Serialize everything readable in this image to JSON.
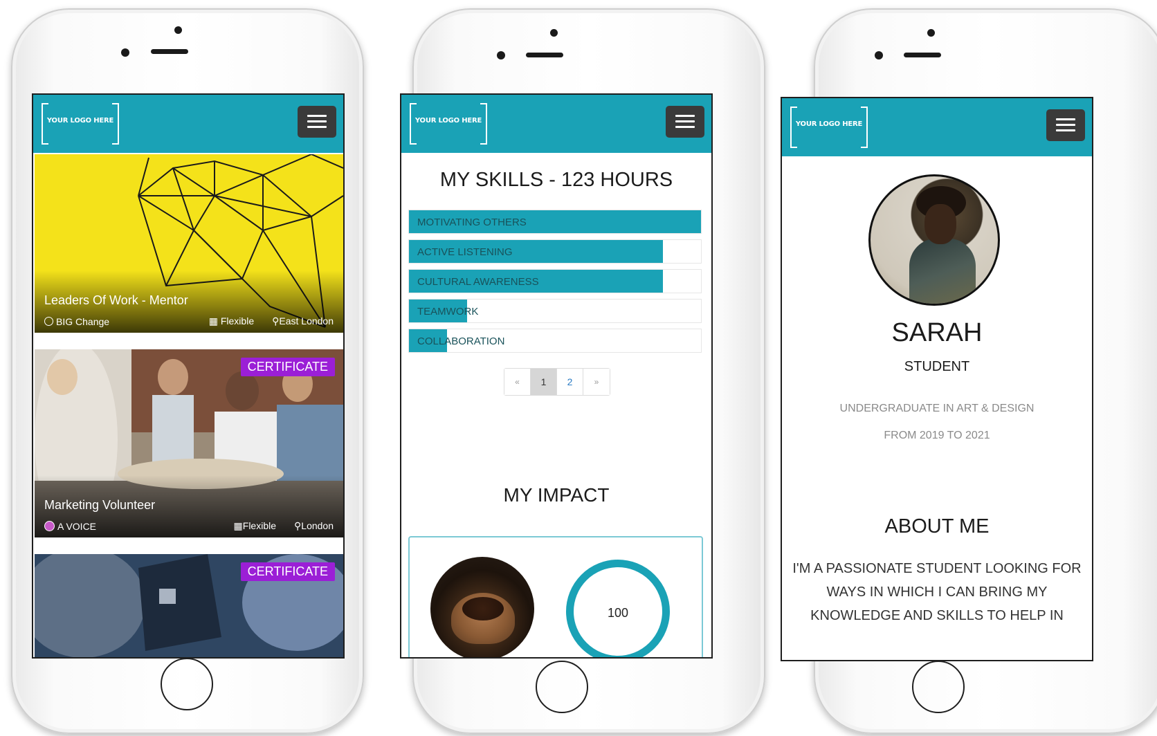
{
  "brand": {
    "accent": "#1aa2b6",
    "certificate": "#9b1fd6"
  },
  "logo_text": "YOUR LOGO HERE",
  "phone1": {
    "cards": [
      {
        "title": "Leaders Of Work - Mentor",
        "org": "BIG Change",
        "schedule": "Flexible",
        "location": "East London"
      },
      {
        "title": "Marketing Volunteer",
        "org": "A VOICE",
        "schedule": "Flexible",
        "location": "London",
        "badge": "CERTIFICATE"
      },
      {
        "badge": "CERTIFICATE"
      }
    ]
  },
  "phone2": {
    "skills_heading": "MY SKILLS - 123 HOURS",
    "skills": [
      {
        "label": "MOTIVATING OTHERS",
        "level": 1.0
      },
      {
        "label": "ACTIVE LISTENING",
        "level": 0.87
      },
      {
        "label": "CULTURAL AWARENESS",
        "level": 0.87
      },
      {
        "label": "TEAMWORK",
        "level": 0.2
      },
      {
        "label": "COLLABORATION",
        "level": 0.13
      }
    ],
    "pagination": {
      "prev": "«",
      "pages": [
        "1",
        "2"
      ],
      "next": "»",
      "current": "1"
    },
    "impact_heading": "MY IMPACT",
    "impact_value": "100"
  },
  "phone3": {
    "name": "SARAH",
    "role": "STUDENT",
    "education": "UNDERGRADUATE IN ART & DESIGN",
    "years": "FROM 2019 TO 2021",
    "about_heading": "ABOUT ME",
    "about_text": "I'M A PASSIONATE STUDENT LOOKING FOR WAYS IN WHICH I CAN BRING MY KNOWLEDGE AND SKILLS TO HELP IN"
  }
}
